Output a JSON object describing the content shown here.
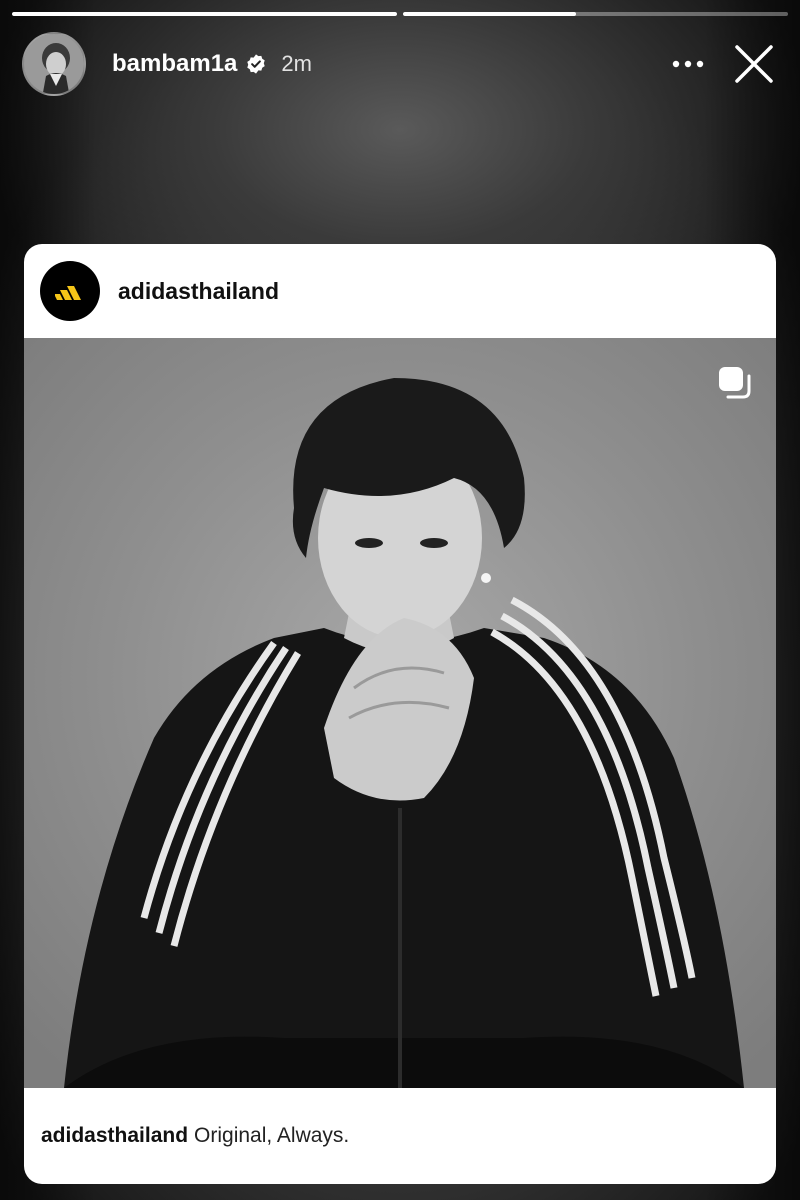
{
  "story": {
    "progress": [
      1.0,
      0.45
    ],
    "user": {
      "username": "bambam1a",
      "verified": true,
      "time": "2m"
    },
    "icons": {
      "verified": "verified-badge-icon",
      "more": "more-horizontal-icon",
      "close": "close-icon"
    }
  },
  "shared_post": {
    "account": "adidasthailand",
    "caption_user": "adidasthailand",
    "caption_text": "Original, Always.",
    "icons": {
      "brand_logo": "adidas-logo-icon",
      "carousel": "carousel-multiple-icon"
    },
    "colors": {
      "brand_logo_bg": "#000000",
      "brand_logo_mark": "#f5c518"
    }
  }
}
